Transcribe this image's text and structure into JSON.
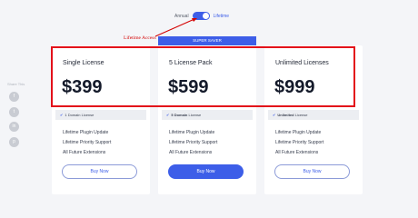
{
  "billing_toggle": {
    "annual_label": "Annual",
    "lifetime_label": "Lifetime",
    "selected": "Lifetime"
  },
  "annotation": {
    "text": "Lifetime Access",
    "color": "#d40000"
  },
  "share": {
    "label": "Share This",
    "buttons": [
      "facebook-icon",
      "twitter-icon",
      "linkedin-icon",
      "pinterest-icon"
    ]
  },
  "badge": "SUPER SAVER",
  "plans": [
    {
      "name": "Single License",
      "price": "$399",
      "domains_count": "1 Domain",
      "domains_suffix": " License",
      "features": [
        "Lifetime Plugin Update",
        "Lifetime Priority Support",
        "All Future Extensions"
      ],
      "cta": "Buy Now"
    },
    {
      "name": "5 License Pack",
      "price": "$599",
      "domains_count": "5 Domain",
      "domains_suffix": " License",
      "features": [
        "Lifetime Plugin Update",
        "Lifetime Priority Support",
        "All Future Extensions"
      ],
      "cta": "Buy Now"
    },
    {
      "name": "Unlimited Licenses",
      "price": "$999",
      "domains_count": "Unlimited",
      "domains_suffix": " License",
      "features": [
        "Lifetime Plugin Update",
        "Lifetime Priority Support",
        "All Future Extensions"
      ],
      "cta": "Buy Now"
    }
  ],
  "colors": {
    "accent": "#3d5ee8",
    "highlight": "#e3101a",
    "background": "#f4f5f8"
  }
}
